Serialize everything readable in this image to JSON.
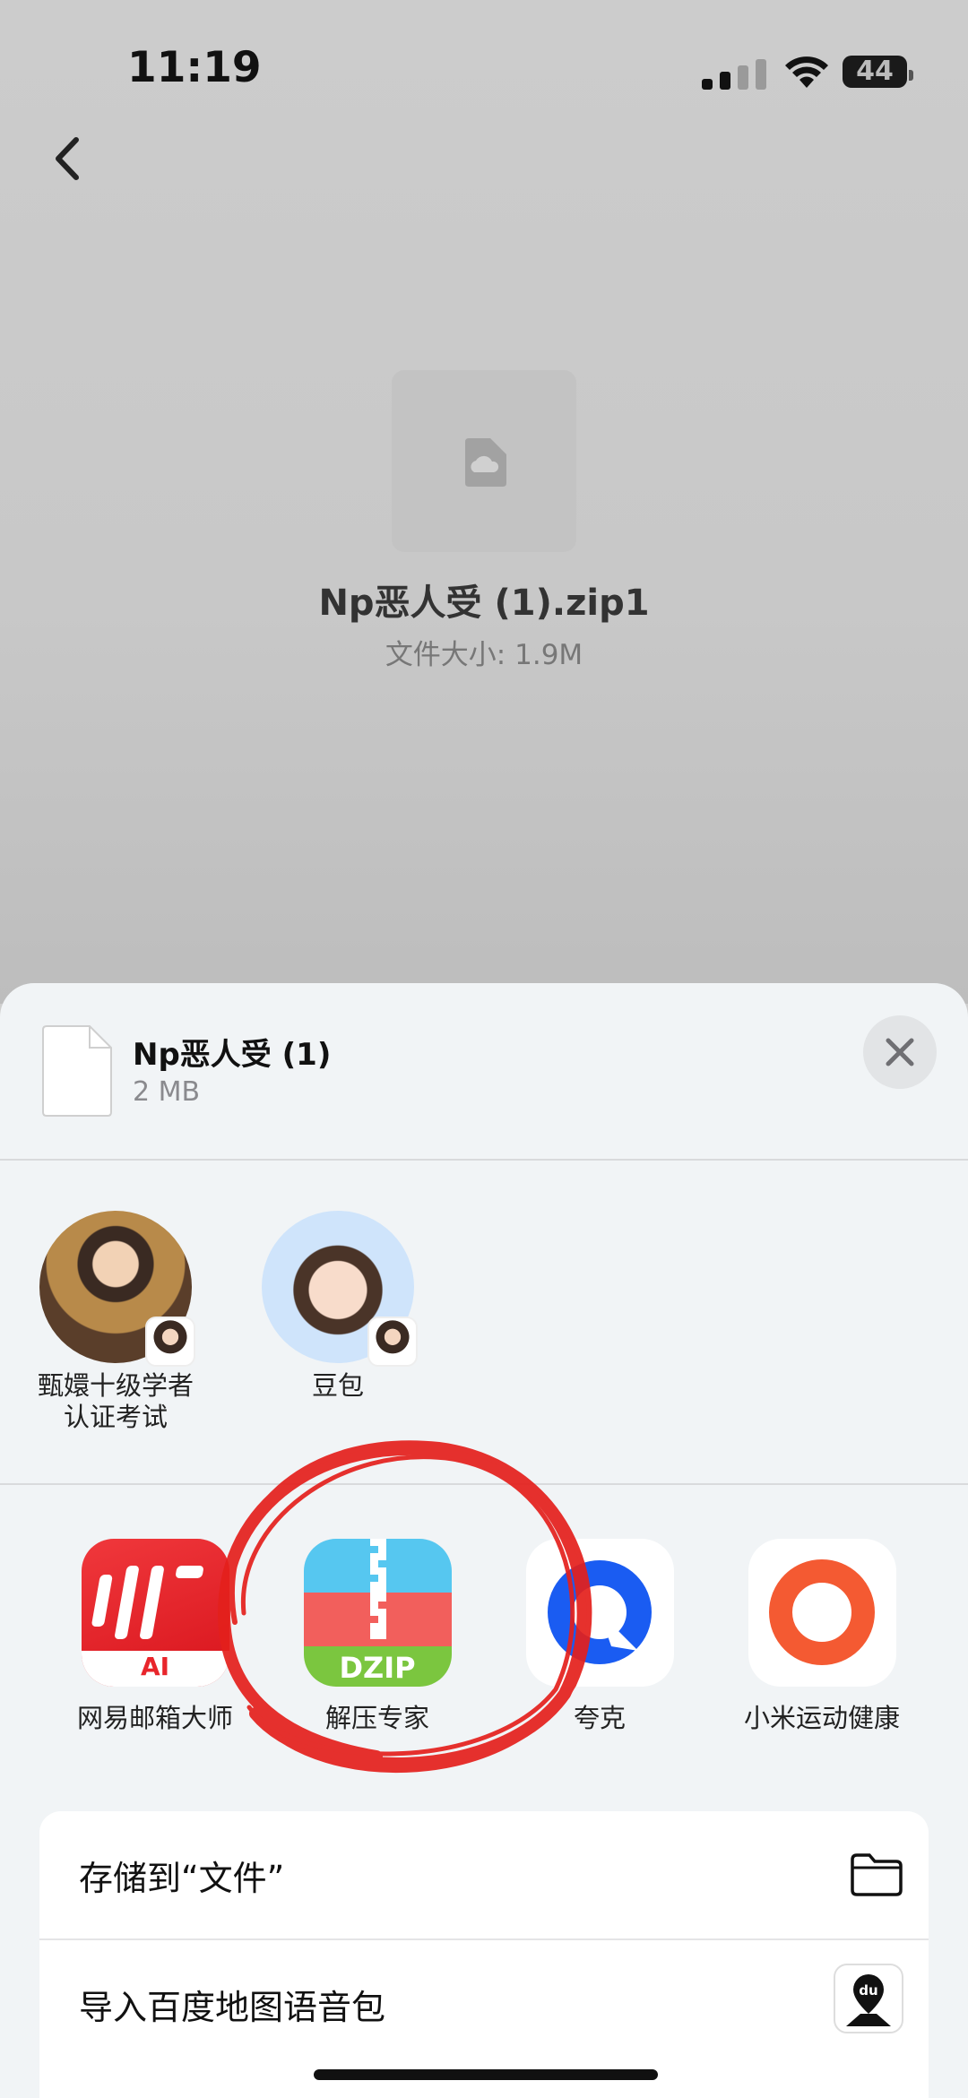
{
  "status": {
    "time": "11:19",
    "battery": "44"
  },
  "file": {
    "name": "Np恶人受 (1).zip1",
    "size_label": "文件大小: 1.9M"
  },
  "sheet": {
    "title": "Np恶人受 (1)",
    "subtitle": "2 MB",
    "people": [
      {
        "label": "甄嬛十级学者\n认证考试"
      },
      {
        "label": "豆包"
      }
    ],
    "apps": [
      {
        "label": "网易邮箱大师",
        "color": "#e8252b"
      },
      {
        "label": "解压专家",
        "color": "#56c7f0"
      },
      {
        "label": "夸克",
        "color": "#1a5cf2"
      },
      {
        "label": "小米运动健康",
        "color": "#f45a32"
      }
    ],
    "actions": [
      {
        "label": "存储到“文件”",
        "icon": "folder-icon"
      },
      {
        "label": "导入百度地图语音包",
        "icon": "baidu-map-icon"
      }
    ],
    "annotation_color": "#e4201c"
  }
}
